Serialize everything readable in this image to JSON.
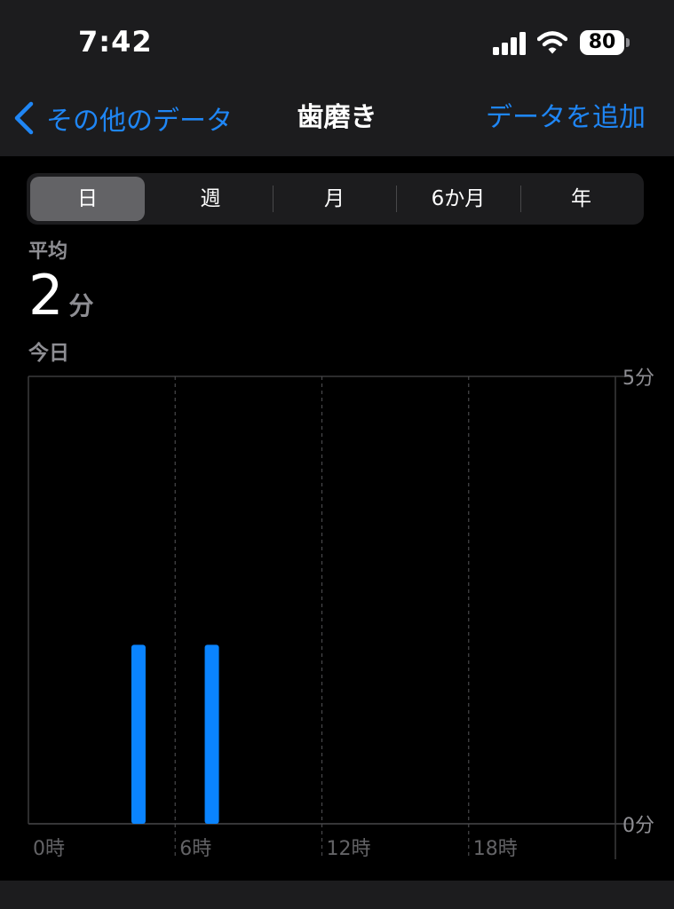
{
  "status_bar": {
    "time": "7:42",
    "battery": "80",
    "icons": [
      "cellular-signal-icon",
      "wifi-icon",
      "battery-icon"
    ]
  },
  "nav": {
    "back_label": "その他のデータ",
    "title": "歯磨き",
    "action_label": "データを追加",
    "accent_color": "#1f86f5"
  },
  "segments": [
    {
      "label": "日",
      "selected": true
    },
    {
      "label": "週",
      "selected": false
    },
    {
      "label": "月",
      "selected": false
    },
    {
      "label": "6か月",
      "selected": false
    },
    {
      "label": "年",
      "selected": false
    }
  ],
  "summary": {
    "label": "平均",
    "value": "2",
    "unit": "分",
    "date": "今日"
  },
  "chart_data": {
    "type": "bar",
    "bar_color": "#0a84ff",
    "x_unit": "時",
    "xlim": [
      0,
      24
    ],
    "ylim": [
      0,
      5
    ],
    "y_tick_labels": [
      "5分",
      "0分"
    ],
    "x_tick_labels": [
      "0時",
      "6時",
      "12時",
      "18時"
    ],
    "grid": true,
    "bars": [
      {
        "hour": 4,
        "value": 2
      },
      {
        "hour": 7,
        "value": 2
      }
    ]
  }
}
